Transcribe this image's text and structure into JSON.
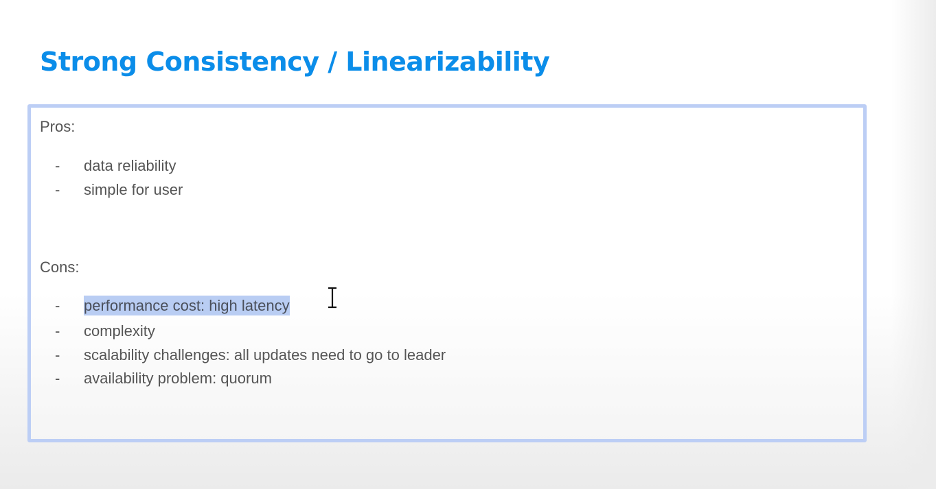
{
  "slide": {
    "title": "Strong Consistency / Linearizability",
    "pros_heading": "Pros:",
    "pros": [
      "data reliability",
      "simple for user"
    ],
    "cons_heading": "Cons:",
    "cons": [
      "performance cost: high latency",
      "complexity",
      "scalability challenges: all updates need to go to leader",
      "availability problem: quorum"
    ],
    "bullet": "-",
    "highlight_color": "#b9cdf3",
    "title_color": "#0b8de9"
  }
}
